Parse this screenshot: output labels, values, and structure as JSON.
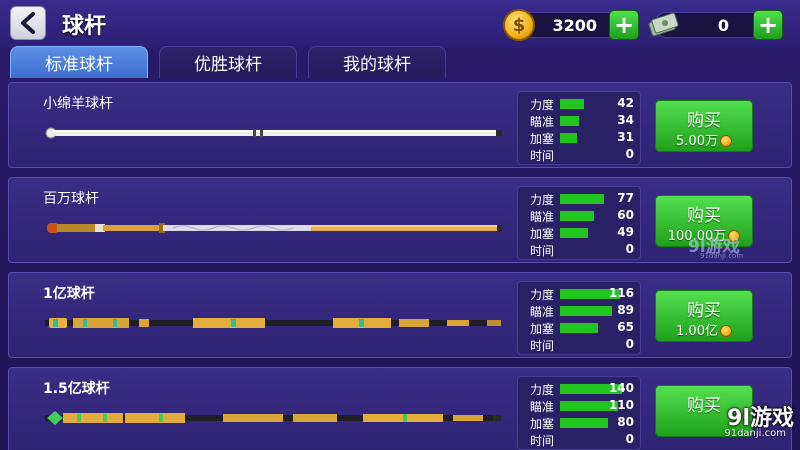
{
  "header": {
    "title": "球杆",
    "coins": "3200",
    "coin_symbol": "$",
    "cash": "0",
    "plus": "+"
  },
  "tabs": [
    {
      "label": "标准球杆",
      "active": true
    },
    {
      "label": "优胜球杆",
      "active": false
    },
    {
      "label": "我的球杆",
      "active": false
    }
  ],
  "stat_labels": [
    "力度",
    "瞄准",
    "加塞",
    "时间"
  ],
  "cues": [
    {
      "name": "小绵羊球杆",
      "stats": [
        42,
        34,
        31,
        0
      ],
      "buy_label": "购买",
      "price": "5.00万"
    },
    {
      "name": "百万球杆",
      "stats": [
        77,
        60,
        49,
        0
      ],
      "buy_label": "购买",
      "price": "100.00万"
    },
    {
      "name": "1亿球杆",
      "stats": [
        116,
        89,
        65,
        0
      ],
      "buy_label": "购买",
      "price": "1.00亿"
    },
    {
      "name": "1.5亿球杆",
      "stats": [
        140,
        110,
        80,
        0
      ],
      "buy_label": "购买",
      "price": ""
    }
  ],
  "watermark": {
    "main": "9l游戏",
    "sub": "91danji.com",
    "small_main": "9l游戏",
    "small_sub": "91danji.com"
  },
  "colors": {
    "background": "#2a1b6b",
    "stat_bar": "#22c51f",
    "buy_button": "#1fa01b",
    "tab_active": "#4a7fd9"
  },
  "icons": {
    "back": "chevron-left-icon",
    "coin": "coin-icon",
    "cash": "cash-stack-icon",
    "plus": "plus-icon"
  }
}
